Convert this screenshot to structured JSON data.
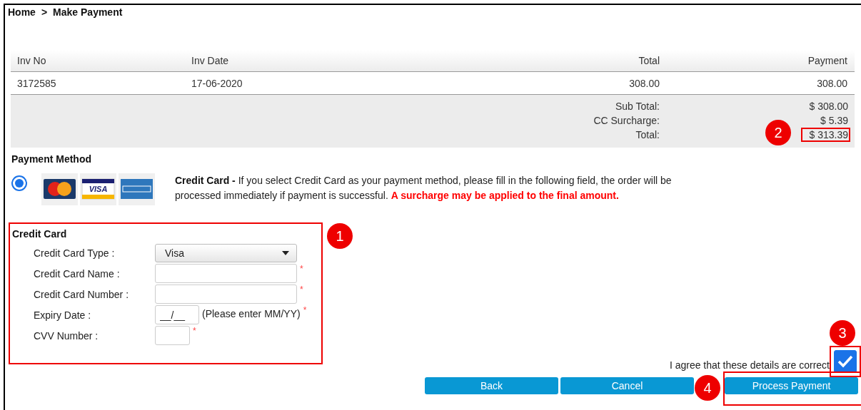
{
  "breadcrumb": [
    "Home",
    ">",
    "Make Payment"
  ],
  "table": {
    "columns": [
      "Inv No",
      "Inv Date",
      "Total",
      "Payment"
    ],
    "rows": [
      [
        "3172585",
        "17-06-2020",
        "308.00",
        "308.00"
      ]
    ],
    "summary": [
      {
        "label": "Sub Total:",
        "value": "$ 308.00",
        "highlighted": false
      },
      {
        "label": "CC Surcharge:",
        "value": "$ 5.39",
        "highlighted": false
      },
      {
        "label": "Total:",
        "value": "$ 313.39",
        "highlighted": true
      }
    ]
  },
  "payment_method": {
    "title": "Payment Method",
    "selected": true,
    "logos": [
      {
        "kind": "mastercard"
      },
      {
        "kind": "visa",
        "text": "VISA"
      },
      {
        "kind": "amex"
      }
    ],
    "description": "**Credit Card -** If you select Credit Card as your payment method, please fill in the following field, the order will be processed immediately if payment is successful.",
    "warning": "A surcharge may be applied to the final amount."
  },
  "credit_card": {
    "title": "Credit Card",
    "highlighted": true,
    "fields": [
      {
        "label": "Credit Card Type :",
        "kind": "select",
        "value": "Visa"
      },
      {
        "label": "Credit Card Name :",
        "kind": "text",
        "required_mark": "*"
      },
      {
        "label": "Credit Card Number :",
        "kind": "text",
        "required_mark": "*"
      },
      {
        "label": "Expiry Date :",
        "kind": "expiry",
        "value": "__/__",
        "hint": "(Please enter MM/YY)",
        "required_mark": "*"
      },
      {
        "label": "CVV Number :",
        "kind": "cvv",
        "required_mark": "*"
      }
    ]
  },
  "agree": {
    "label": "I agree that these details are correct",
    "checked": true,
    "highlighted": true
  },
  "buttons": [
    {
      "label": "Back",
      "highlighted": false
    },
    {
      "label": "Cancel",
      "highlighted": false
    },
    {
      "label": "Process Payment",
      "highlighted": true
    }
  ],
  "callouts": [
    "1",
    "2",
    "3",
    "4"
  ]
}
